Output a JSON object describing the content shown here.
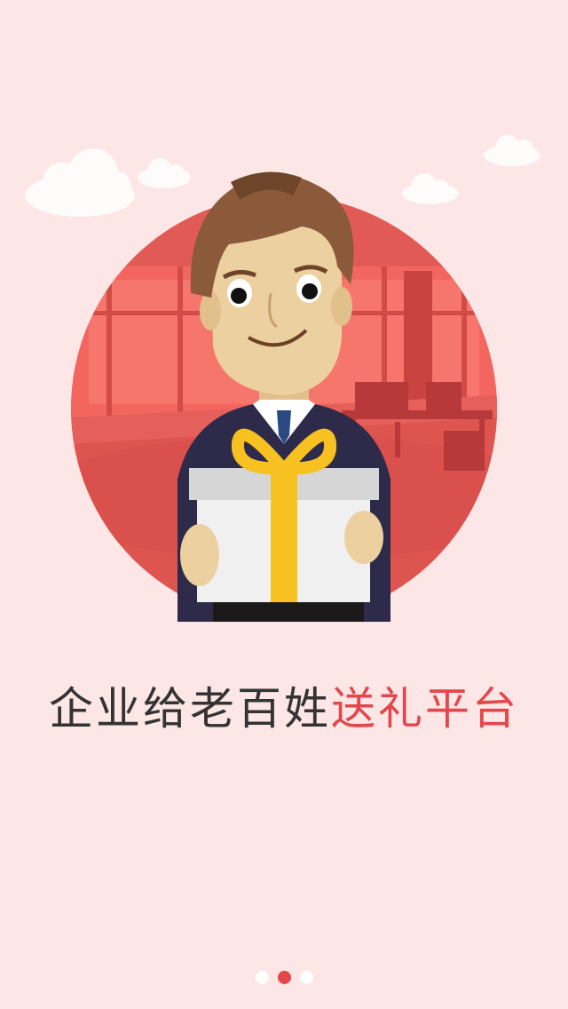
{
  "tagline": {
    "plain": "企业给老百姓",
    "highlight": "送礼平台"
  },
  "pager": {
    "total": 3,
    "active_index": 1
  },
  "colors": {
    "background": "#fde6e6",
    "accent": "#e2474b",
    "text": "#333333",
    "circle": "#e15a56",
    "ribbon": "#f7c221"
  },
  "icons": [
    "cloud-icon",
    "businessman-with-gift-illustration"
  ]
}
